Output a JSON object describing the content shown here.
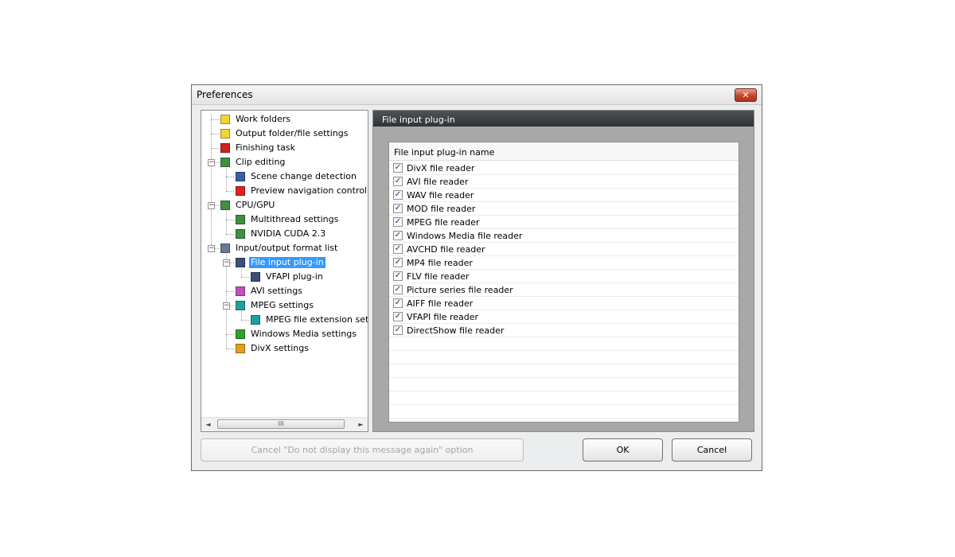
{
  "window": {
    "title": "Preferences",
    "close_glyph": "✕"
  },
  "tree": {
    "items": [
      {
        "label": "Work folders",
        "icon": "folder-icon",
        "color": "#f2d530"
      },
      {
        "label": "Output folder/file settings",
        "icon": "folder-settings-icon",
        "color": "#f2d530"
      },
      {
        "label": "Finishing task",
        "icon": "power-icon",
        "color": "#d42020"
      },
      {
        "label": "Clip editing",
        "icon": "document-edit-icon",
        "color": "#3f8f3f"
      },
      {
        "label": "Scene change detection",
        "icon": "film-icon",
        "color": "#3a5fa8"
      },
      {
        "label": "Preview navigation control",
        "icon": "red-arrow-icon",
        "color": "#e02020"
      },
      {
        "label": "CPU/GPU",
        "icon": "document-edit-icon",
        "color": "#3f8f3f"
      },
      {
        "label": "Multithread settings",
        "icon": "document-edit-icon",
        "color": "#3f8f3f"
      },
      {
        "label": "NVIDIA CUDA 2.3",
        "icon": "document-edit-icon",
        "color": "#3f8f3f"
      },
      {
        "label": "Input/output format list",
        "icon": "list-icon",
        "color": "#6a7a90"
      },
      {
        "label": "File input plug-in",
        "icon": "plugin-icon",
        "color": "#3d4f7a"
      },
      {
        "label": "VFAPI plug-in",
        "icon": "plugin-icon",
        "color": "#3d4f7a"
      },
      {
        "label": "AVI settings",
        "icon": "avi-file-icon",
        "color": "#c050c0"
      },
      {
        "label": "MPEG settings",
        "icon": "mpeg-file-icon",
        "color": "#20a0a0"
      },
      {
        "label": "MPEG file extension settings",
        "icon": "mpeg-file-icon",
        "color": "#20a0a0"
      },
      {
        "label": "Windows Media settings",
        "icon": "wm-file-icon",
        "color": "#30a030"
      },
      {
        "label": "DivX settings",
        "icon": "divx-file-icon",
        "color": "#e0a020"
      }
    ],
    "scroll_left": "◄",
    "scroll_right": "►",
    "scroll_grip": "III"
  },
  "panel": {
    "title": "File input plug-in",
    "column_header": "File input plug-in name",
    "check_glyph": "✓",
    "rows": [
      {
        "label": "DivX file reader",
        "checked": true
      },
      {
        "label": "AVI file reader",
        "checked": true
      },
      {
        "label": "WAV file reader",
        "checked": true
      },
      {
        "label": "MOD file reader",
        "checked": true
      },
      {
        "label": "MPEG file reader",
        "checked": true
      },
      {
        "label": "Windows Media file reader",
        "checked": true
      },
      {
        "label": "AVCHD file reader",
        "checked": true
      },
      {
        "label": "MP4 file reader",
        "checked": true
      },
      {
        "label": "FLV file reader",
        "checked": true
      },
      {
        "label": "Picture series file reader",
        "checked": true
      },
      {
        "label": "AIFF file reader",
        "checked": true
      },
      {
        "label": "VFAPI file reader",
        "checked": true
      },
      {
        "label": "DirectShow file reader",
        "checked": true
      }
    ]
  },
  "buttons": {
    "cancel_option": "Cancel \"Do not display this message again\" option",
    "ok": "OK",
    "cancel": "Cancel"
  }
}
